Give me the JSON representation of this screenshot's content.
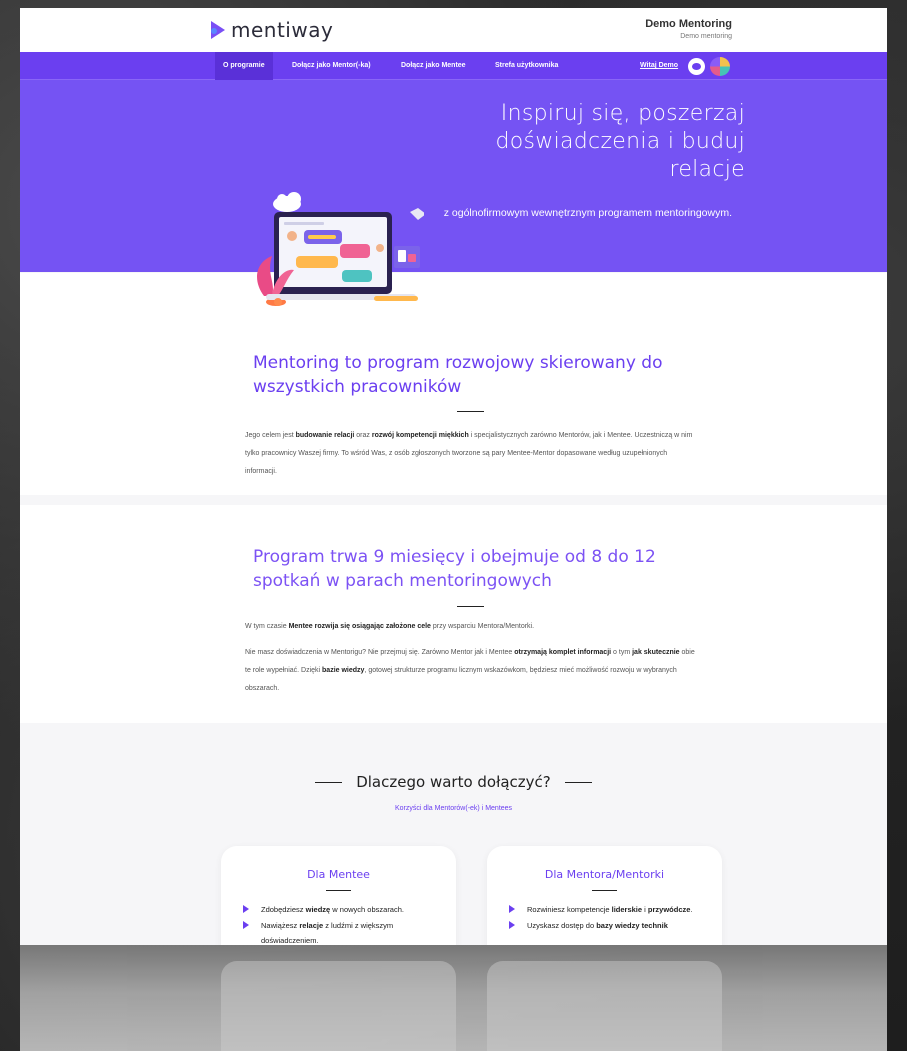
{
  "brand": {
    "logo_text": "mentiway",
    "tenant_name": "Demo Mentoring",
    "tenant_sub": "Demo mentoring"
  },
  "nav": {
    "items": [
      {
        "label": "O programie",
        "active": true
      },
      {
        "label": "Dołącz jako Mentor(-ka)",
        "active": false
      },
      {
        "label": "Dołącz jako Mentee",
        "active": false
      },
      {
        "label": "Strefa użytkownika",
        "active": false
      }
    ],
    "user_link": "Witaj Demo",
    "icons": [
      "chat-icon",
      "avatar-icon"
    ]
  },
  "hero": {
    "title": "Inspiruj się, poszerzaj doświadczenia i buduj relacje",
    "subtitle": "z ogólnofirmowym wewnętrznym programem mentoringowym."
  },
  "section1": {
    "heading": "Mentoring to program rozwojowy skierowany do wszystkich pracowników",
    "p_a": "Jego celem jest ",
    "p_b1": "budowanie relacji",
    "p_c": " oraz ",
    "p_b2": "rozwój kompetencji miękkich",
    "p_d": " i specjalistycznych zarówno Mentorów, jak i Mentee. Uczestniczą w nim tylko pracownicy Waszej firmy. To wśród Was, z osób zgłoszonych tworzone są pary Mentee-Mentor dopasowane według uzupełnionych informacji."
  },
  "section2": {
    "heading": "Program trwa 9 miesięcy i obejmuje od 8 do 12 spotkań w parach mentoringowych",
    "p1_a": "W tym czasie ",
    "p1_b": "Mentee rozwija się osiągając założone cele",
    "p1_c": " przy wsparciu Mentora/Mentorki.",
    "p2_a": "Nie masz doświadczenia w Mentorigu? Nie przejmuj się. Zarówno Mentor jak i Mentee ",
    "p2_b": "otrzymają komplet informacji",
    "p2_c": " o tym ",
    "p2_d": "jak skutecznie",
    "p2_e": " obie te role wypełniać. Dzięki ",
    "p2_f": "bazie wiedzy",
    "p2_g": ", gotowej strukturze programu licznym wskazówkom, będziesz mieć możliwość rozwoju w wybranych obszarach."
  },
  "section3": {
    "heading": "Dlaczego warto dołączyć?",
    "subheading": "Korzyści dla Mentorów(-ek) i Mentees",
    "card_mentee": {
      "title": "Dla Mentee",
      "items": [
        {
          "a": "Zdobędziesz ",
          "b": "wiedzę",
          "c": " w nowych obszarach."
        },
        {
          "a": "Nawiążesz ",
          "b": "relacje",
          "c": " z ludźmi z większym doświadczeniem."
        }
      ]
    },
    "card_mentor": {
      "title": "Dla Mentora/Mentorki",
      "items": [
        {
          "a": "Rozwiniesz kompetencje ",
          "b": "liderskie",
          "c": " i ",
          "d": "przywódcze",
          "e": "."
        },
        {
          "a": "Uzyskasz dostęp do ",
          "b": "bazy wiedzy technik",
          "c": ""
        }
      ]
    }
  },
  "colors": {
    "accent": "#6b3ff0",
    "hero_bg": "#7553f3",
    "nav_bg": "#6b3ff0"
  }
}
